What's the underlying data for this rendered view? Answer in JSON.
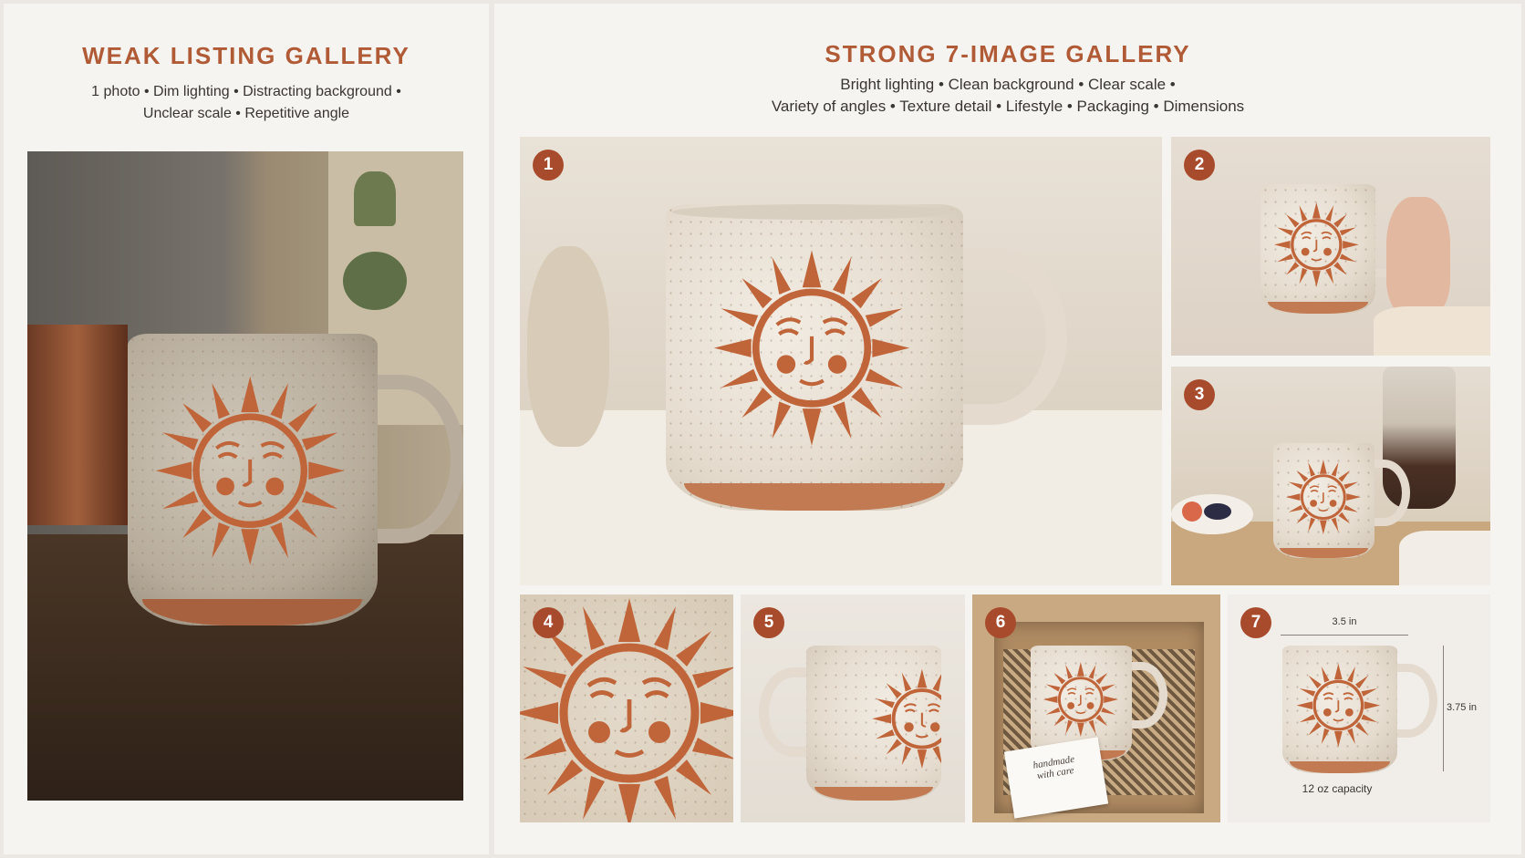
{
  "left_panel": {
    "title": "WEAK LISTING GALLERY",
    "subtitle_line1": "1 photo • Dim lighting • Distracting background •",
    "subtitle_line2": "Unclear scale • Repetitive angle"
  },
  "right_panel": {
    "title": "STRONG 7-IMAGE GALLERY",
    "subtitle_line1": "Bright lighting • Clean background • Clear scale •",
    "subtitle_line2": "Variety of angles • Texture detail • Lifestyle • Packaging • Dimensions",
    "photos": [
      {
        "badge": "1"
      },
      {
        "badge": "2"
      },
      {
        "badge": "3"
      },
      {
        "badge": "4"
      },
      {
        "badge": "5"
      },
      {
        "badge": "6",
        "card_line1": "handmade",
        "card_line2": "with care"
      },
      {
        "badge": "7",
        "width_label": "3.5 in",
        "height_label": "3.75 in",
        "capacity_label": "12 oz capacity"
      }
    ]
  },
  "colors": {
    "accent": "#b05a36",
    "badge": "#a84b2c",
    "terracotta": "#c27a52",
    "glaze": "#e6ddd0",
    "page_bg": "#f6f4f0"
  },
  "icons": {
    "sun_motif": "sun-face-icon"
  }
}
